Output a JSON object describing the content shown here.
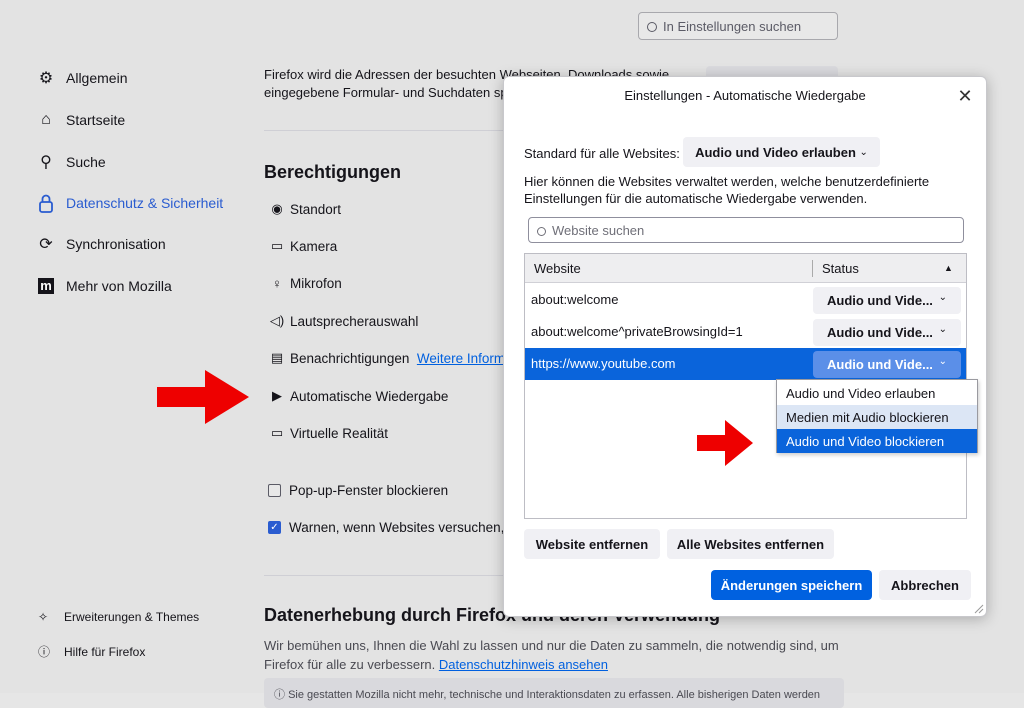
{
  "background": {
    "search_placeholder": "In Einstellungen suchen",
    "nav": [
      {
        "label": "Allgemein",
        "icon": "gear-icon"
      },
      {
        "label": "Startseite",
        "icon": "home-icon"
      },
      {
        "label": "Suche",
        "icon": "search-icon"
      },
      {
        "label": "Datenschutz & Sicherheit",
        "icon": "lock-icon"
      },
      {
        "label": "Synchronisation",
        "icon": "sync-icon"
      },
      {
        "label": "Mehr von Mozilla",
        "icon": "mozilla-icon"
      }
    ],
    "nav_bottom": [
      {
        "label": "Erweiterungen & Themes",
        "icon": "puzzle-icon"
      },
      {
        "label": "Hilfe für Firefox",
        "icon": "help-icon"
      }
    ],
    "intro_text_1": "Firefox wird die Adressen der besuchten Webseiten, Downloads sowie",
    "intro_text_2": "eingegebene Formular- und Suchdaten sp",
    "permissions_heading": "Berechtigungen",
    "permissions": [
      {
        "label": "Standort",
        "icon": "location-icon"
      },
      {
        "label": "Kamera",
        "icon": "camera-icon"
      },
      {
        "label": "Mikrofon",
        "icon": "microphone-icon"
      },
      {
        "label": "Lautsprecherauswahl",
        "icon": "speaker-icon"
      },
      {
        "label": "Benachrichtigungen",
        "icon": "notification-icon"
      },
      {
        "label": "Automatische Wiedergabe",
        "icon": "autoplay-icon"
      },
      {
        "label": "Virtuelle Realität",
        "icon": "vr-icon"
      }
    ],
    "more_info_link": "Weitere Informa",
    "popup_block": "Pop-up-Fenster blockieren",
    "warn_addons": "Warnen, wenn Websites versuchen, A",
    "data_heading": "Datenerhebung durch Firefox und deren Verwendung",
    "data_text_1": "Wir bemühen uns, Ihnen die Wahl zu lassen und nur die Daten zu sammeln, die notwendig sind, um",
    "data_text_2": "Firefox für alle zu verbessern.",
    "data_link": "Datenschutzhinweis ansehen",
    "data_text_3": "Sie gestatten Mozilla nicht mehr, technische und Interaktionsdaten zu erfassen. Alle bisherigen Daten werden"
  },
  "dialog": {
    "title": "Einstellungen - Automatische Wiedergabe",
    "default_label": "Standard für alle Websites:",
    "default_value": "Audio und Video erlauben",
    "description": "Hier können die Websites verwaltet werden, welche benutzerdefinierte Einstellungen für die automatische Wiedergabe verwenden.",
    "search_placeholder": "Website suchen",
    "columns": {
      "website": "Website",
      "status": "Status"
    },
    "rows": [
      {
        "site": "about:welcome",
        "status": "Audio und Vide..."
      },
      {
        "site": "about:welcome^privateBrowsingId=1",
        "status": "Audio und Vide..."
      },
      {
        "site": "https://www.youtube.com",
        "status": "Audio und Vide..."
      }
    ],
    "dropdown_options": [
      "Audio und Video erlauben",
      "Medien mit Audio blockieren",
      "Audio und Video blockieren"
    ],
    "remove_website": "Website entfernen",
    "remove_all": "Alle Websites entfernen",
    "save": "Änderungen speichern",
    "cancel": "Abbrechen"
  }
}
